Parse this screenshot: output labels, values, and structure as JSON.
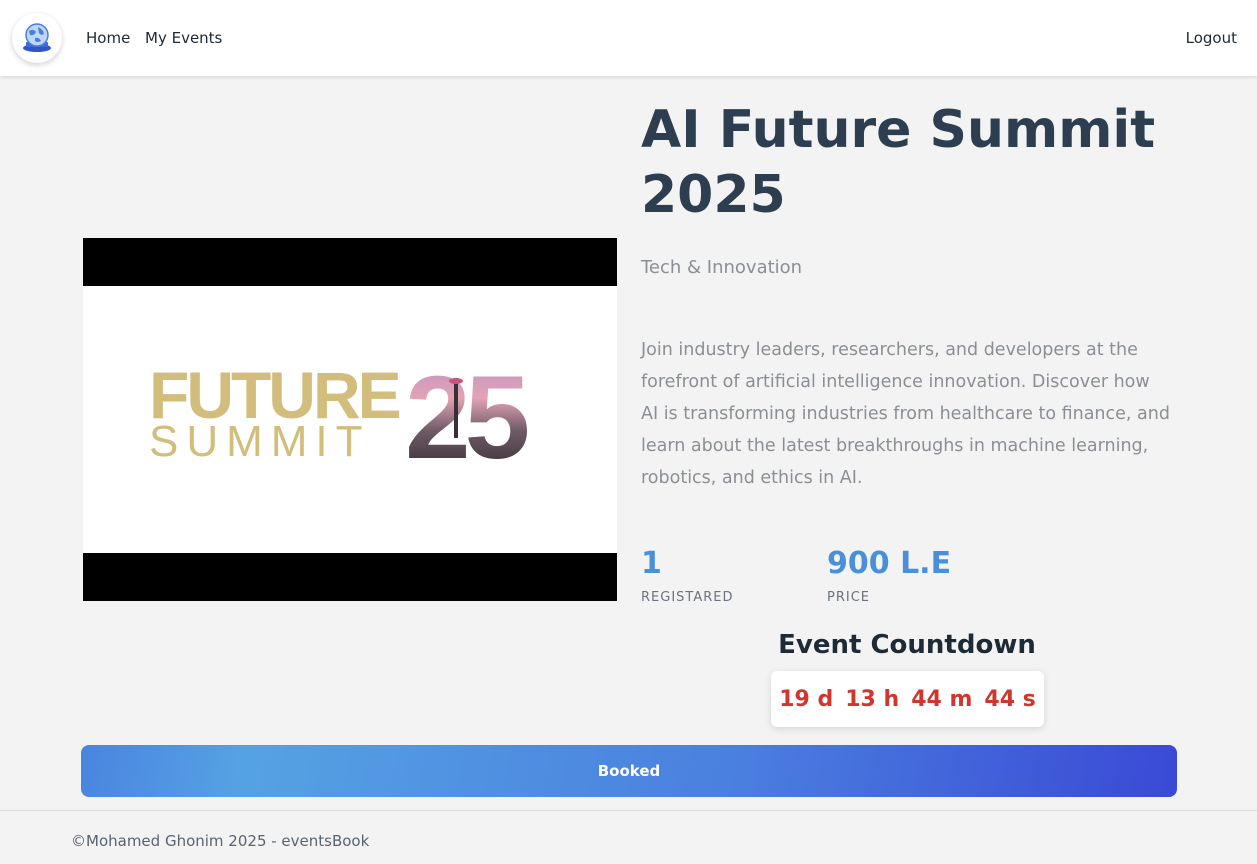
{
  "nav": {
    "logo_icon": "globe-laptop-icon",
    "home": "Home",
    "my_events": "My Events",
    "logout": "Logout"
  },
  "event": {
    "image_text_top": "FUTURE",
    "image_text_bottom": "SUMMIT",
    "image_number": "25",
    "title": "AI Future Summit 2025",
    "category": "Tech & Innovation",
    "description": "Join industry leaders, researchers, and developers at the forefront of artificial intelligence innovation. Discover how AI is transforming industries from healthcare to finance, and learn about the latest breakthroughs in machine learning, robotics, and ethics in AI.",
    "registered_count": "1",
    "registered_label": "REGISTARED",
    "price": "900 L.E",
    "price_label": "PRICE"
  },
  "countdown": {
    "title": "Event Countdown",
    "days": "19 d",
    "hours": "13 h",
    "minutes": "44 m",
    "seconds": "44 s"
  },
  "action": {
    "button_label": "Booked"
  },
  "footer": {
    "text": "©Mohamed Ghonim 2025 - eventsBook"
  },
  "colors": {
    "accent": "#4a90d9",
    "countdown": "#d0352e",
    "button_start": "#4a84e0",
    "button_end": "#3a49d6",
    "logo_gold": "#d2bd7c"
  }
}
